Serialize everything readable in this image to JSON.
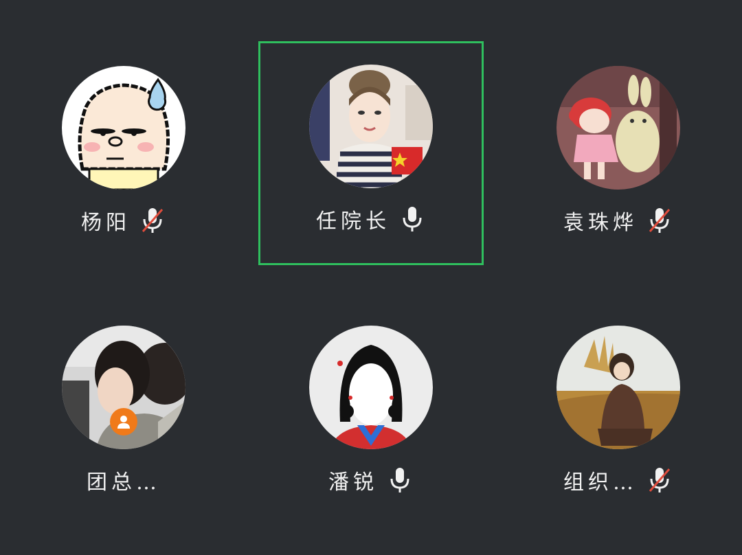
{
  "participants": [
    {
      "name": "杨阳",
      "mic": "muted",
      "active": false,
      "avatar": "cartoon-sheep-avatar"
    },
    {
      "name": "任院长",
      "mic": "on",
      "active": true,
      "avatar": "illustrated-girl-avatar"
    },
    {
      "name": "袁珠烨",
      "mic": "muted",
      "active": false,
      "avatar": "girl-hugging-bunny-avatar"
    },
    {
      "name": "团总…",
      "mic": "none",
      "active": false,
      "avatar": "photo-woman-avatar",
      "badge": "person-badge-icon"
    },
    {
      "name": "潘锐",
      "mic": "on",
      "active": false,
      "avatar": "girl-braids-avatar"
    },
    {
      "name": "组织…",
      "mic": "muted",
      "active": false,
      "avatar": "boy-in-field-avatar"
    }
  ],
  "colors": {
    "background": "#2a2d31",
    "active_border": "#2fbf5e",
    "muted_slash": "#e04c3c",
    "badge": "#f07a1a"
  }
}
